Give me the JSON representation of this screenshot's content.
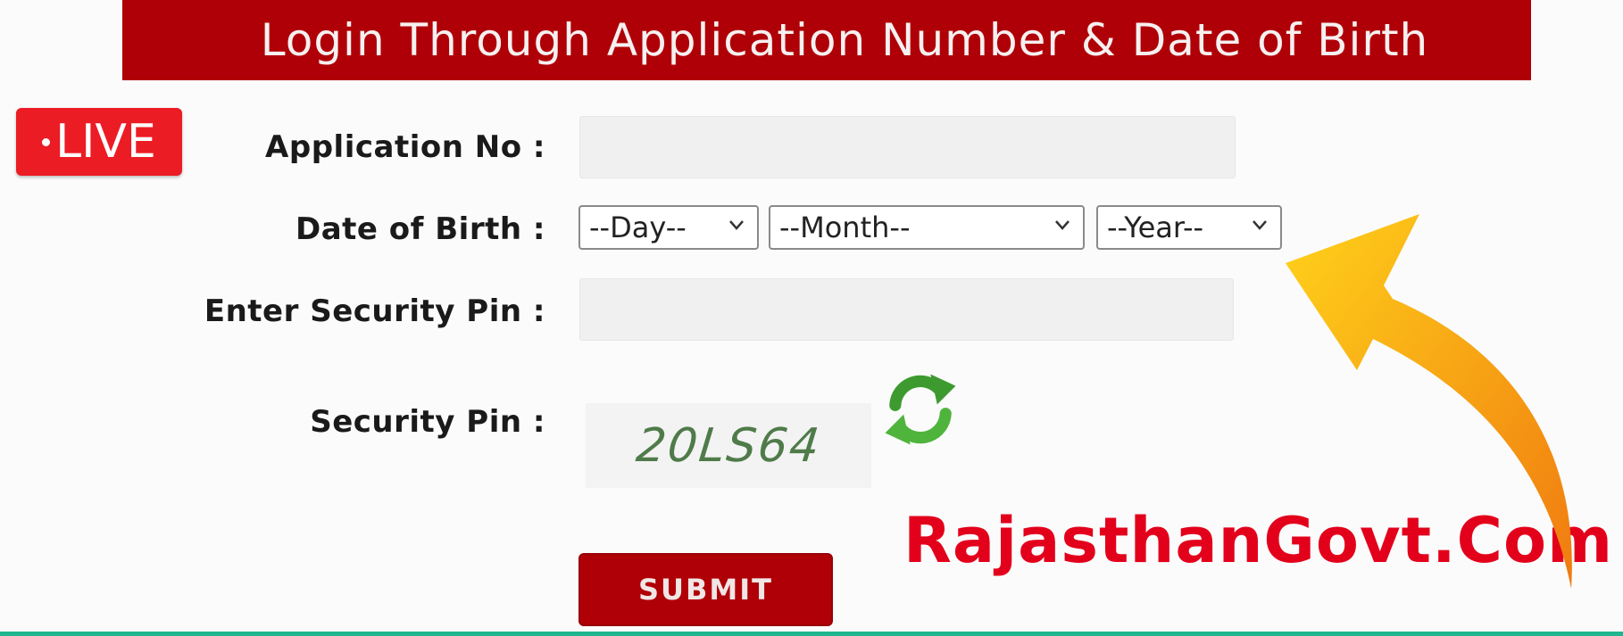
{
  "header": {
    "title": "Login Through Application Number & Date of Birth"
  },
  "badge": {
    "live_label": "LIVE"
  },
  "form": {
    "application_no_label": "Application No :",
    "application_no_value": "",
    "dob_label": "Date of Birth :",
    "day_option": "--Day--",
    "month_option": "--Month--",
    "year_option": "--Year--",
    "security_pin_input_label": "Enter Security Pin :",
    "security_pin_value": "",
    "security_pin_label": "Security Pin :",
    "captcha_text": "20LS64",
    "submit_label": "SUBMIT"
  },
  "watermark": {
    "text": "RajasthanGovt.Com"
  },
  "colors": {
    "header_bg": "#b00007",
    "live_bg": "#ec1c24",
    "watermark": "#e3001b",
    "arrow": "#f7a21b"
  },
  "icons": {
    "refresh": "refresh-icon",
    "dropdown": "chevron-down-icon",
    "pointer": "curved-arrow-icon"
  }
}
